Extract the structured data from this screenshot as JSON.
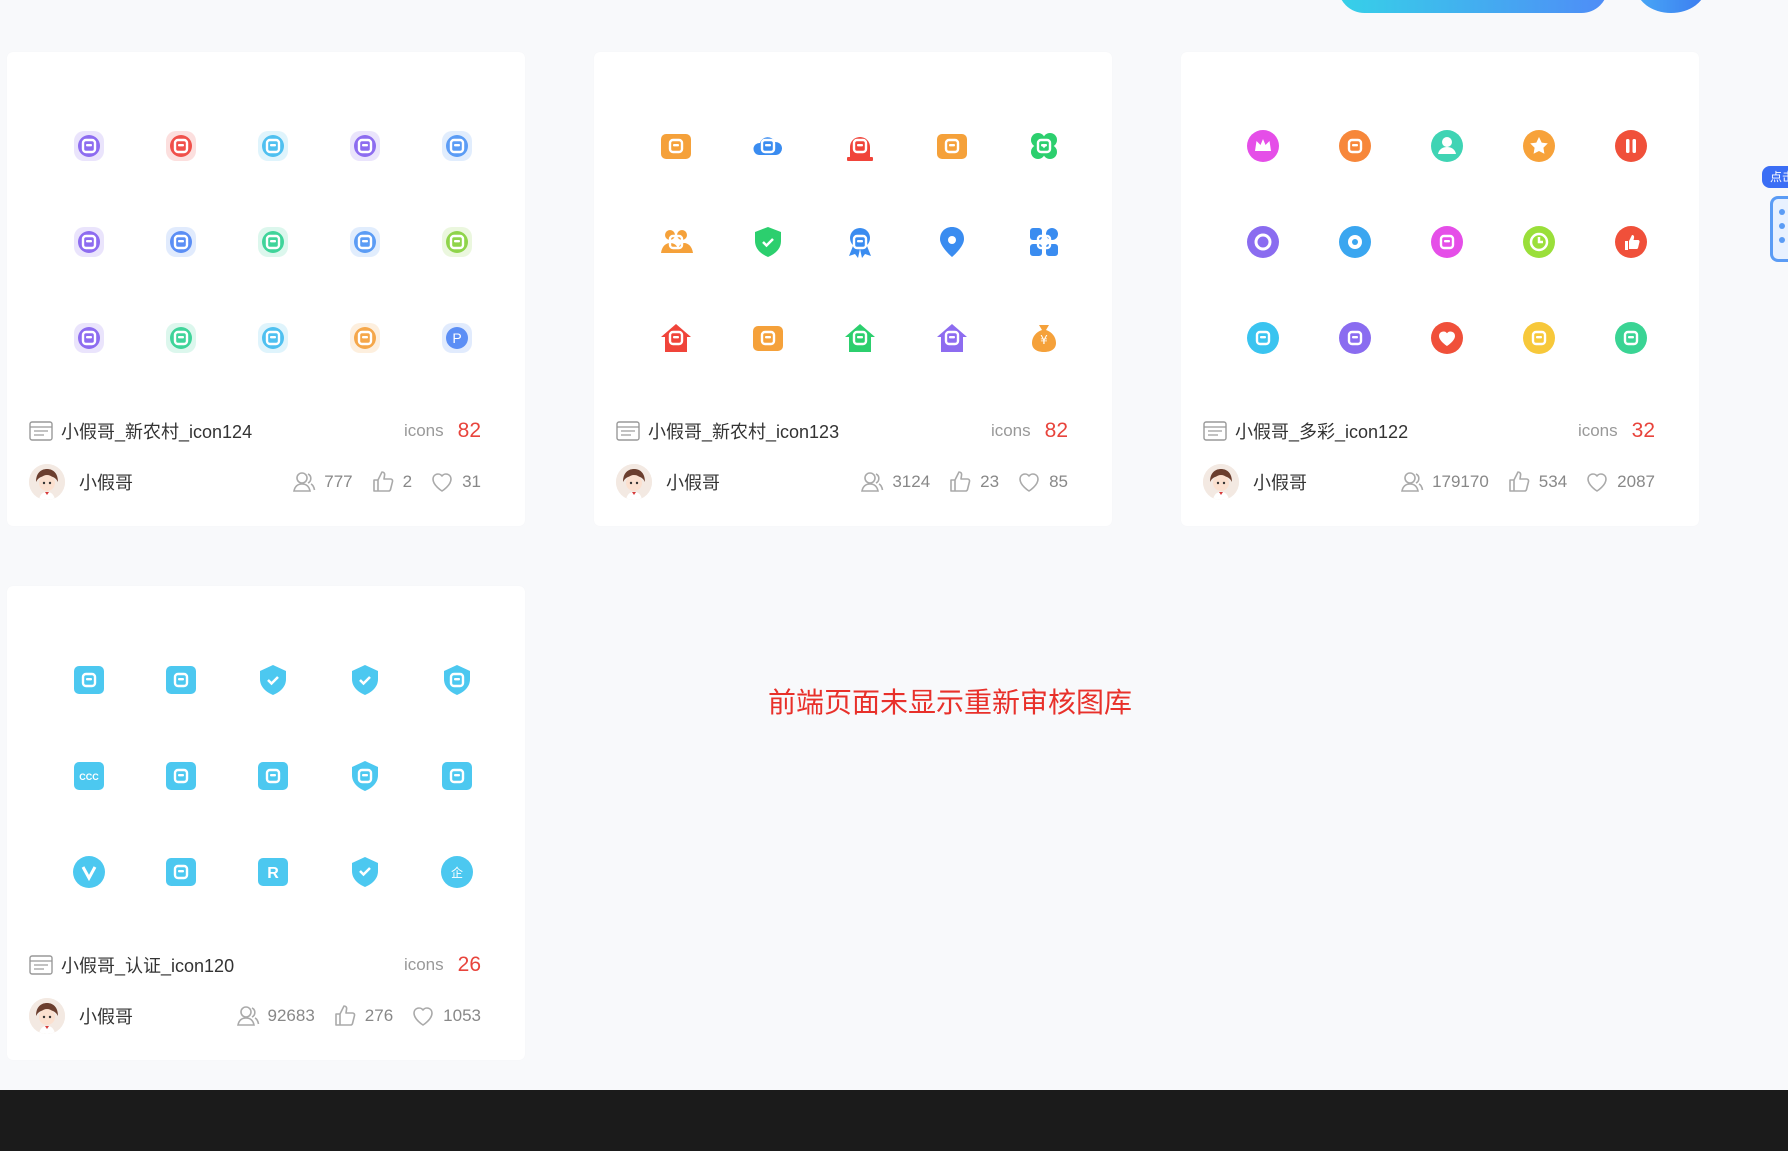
{
  "notice": "前端页面未显示重新审核图库",
  "side_tab_label": "点击",
  "labels": {
    "icons": "icons"
  },
  "colors": {
    "count": "#e8443c",
    "notice": "#e8302a",
    "footer": "#1b1b1b"
  },
  "cards": [
    {
      "title": "小假哥_新农村_icon124",
      "icons_count": "82",
      "author": "小假哥",
      "views": "777",
      "likes": "2",
      "favorites": "31",
      "icons": [
        {
          "name": "service-agent-icon",
          "color": "#8d6cf0"
        },
        {
          "name": "certificate-icon",
          "color": "#f0504a"
        },
        {
          "name": "id-badge-icon",
          "color": "#4fc0f0"
        },
        {
          "name": "person-cheer-icon",
          "color": "#8d6cf0"
        },
        {
          "name": "person-icon",
          "color": "#5b9cf5"
        },
        {
          "name": "notepad-icon",
          "color": "#8d6cf0"
        },
        {
          "name": "scan-icon",
          "color": "#5b8ef5"
        },
        {
          "name": "school-icon",
          "color": "#3fd49a"
        },
        {
          "name": "cloud-icon",
          "color": "#5b9cf5"
        },
        {
          "name": "gift-icon",
          "color": "#8fd44a"
        },
        {
          "name": "chat-dots-icon",
          "color": "#8d6cf0"
        },
        {
          "name": "doc-text-icon",
          "color": "#3fd49a"
        },
        {
          "name": "bar-chart-icon",
          "color": "#4fc0f0"
        },
        {
          "name": "grid-window-icon",
          "color": "#f5a74a"
        },
        {
          "name": "parking-icon",
          "color": "#5b8ef5"
        }
      ]
    },
    {
      "title": "小假哥_新农村_icon123",
      "icons_count": "82",
      "author": "小假哥",
      "views": "3124",
      "likes": "23",
      "favorites": "85",
      "icons": [
        {
          "name": "wallet-icon",
          "color": "#f5a13a"
        },
        {
          "name": "cloud-icon",
          "color": "#3a8cf0"
        },
        {
          "name": "alarm-siren-icon",
          "color": "#f0443a"
        },
        {
          "name": "contact-card-icon",
          "color": "#f5a13a"
        },
        {
          "name": "clover-icon",
          "color": "#2ccf6e"
        },
        {
          "name": "team-icon",
          "color": "#f5a13a"
        },
        {
          "name": "shield-check-icon",
          "color": "#2ccf6e"
        },
        {
          "name": "award-ribbon-icon",
          "color": "#3a8cf0"
        },
        {
          "name": "location-pin-icon",
          "color": "#3a8cf0"
        },
        {
          "name": "apps-icon",
          "color": "#3a8cf0"
        },
        {
          "name": "home-party-icon",
          "color": "#f0443a"
        },
        {
          "name": "id-card-icon",
          "color": "#f5a13a"
        },
        {
          "name": "home-yuan-icon",
          "color": "#2ccf6e"
        },
        {
          "name": "home-repair-icon",
          "color": "#8d6cf0"
        },
        {
          "name": "money-bag-icon",
          "color": "#f5a13a"
        }
      ]
    },
    {
      "title": "小假哥_多彩_icon122",
      "icons_count": "32",
      "author": "小假哥",
      "views": "179170",
      "likes": "534",
      "favorites": "2087",
      "icons": [
        {
          "name": "crown-icon",
          "color": "#e54ee8"
        },
        {
          "name": "wallet-icon",
          "color": "#f7873a"
        },
        {
          "name": "user-icon",
          "color": "#3fd4b4"
        },
        {
          "name": "star-icon",
          "color": "#f7a23a"
        },
        {
          "name": "pause-icon",
          "color": "#f0503a"
        },
        {
          "name": "search-ring-icon",
          "color": "#8a6cf0"
        },
        {
          "name": "settings-icon",
          "color": "#3aa6f0"
        },
        {
          "name": "tag-icon",
          "color": "#e54ee8"
        },
        {
          "name": "clock-icon",
          "color": "#9adf3a"
        },
        {
          "name": "thumbs-up-icon",
          "color": "#f0503a"
        },
        {
          "name": "message-icon",
          "color": "#3ac4f0"
        },
        {
          "name": "document-icon",
          "color": "#8a6cf0"
        },
        {
          "name": "heart-icon",
          "color": "#f0503a"
        },
        {
          "name": "share-icon",
          "color": "#f7c83a"
        },
        {
          "name": "megaphone-icon",
          "color": "#3ad494"
        }
      ]
    },
    {
      "title": "小假哥_认证_icon120",
      "icons_count": "26",
      "author": "小假哥",
      "views": "92683",
      "likes": "276",
      "favorites": "1053",
      "icons": [
        {
          "name": "fingerprint-icon",
          "color": "#4cc8f0"
        },
        {
          "name": "id-card-icon",
          "color": "#4cc8f0"
        },
        {
          "name": "verified-badge-icon",
          "color": "#4cc8f0"
        },
        {
          "name": "shield-check-icon",
          "color": "#4cc8f0"
        },
        {
          "name": "certificate-shield-icon",
          "color": "#4cc8f0"
        },
        {
          "name": "ccc-icon",
          "color": "#4cc8f0"
        },
        {
          "name": "card-verified-icon",
          "color": "#4cc8f0"
        },
        {
          "name": "user-verified-icon",
          "color": "#4cc8f0"
        },
        {
          "name": "star-check-icon",
          "color": "#4cc8f0"
        },
        {
          "name": "doc-verified-icon",
          "color": "#4cc8f0"
        },
        {
          "name": "v-badge-icon",
          "color": "#4cc8f0"
        },
        {
          "name": "video-verified-icon",
          "color": "#4cc8f0"
        },
        {
          "name": "registered-icon",
          "color": "#4cc8f0"
        },
        {
          "name": "diamond-check-icon",
          "color": "#4cc8f0"
        },
        {
          "name": "enterprise-icon",
          "color": "#4cc8f0"
        }
      ]
    }
  ]
}
